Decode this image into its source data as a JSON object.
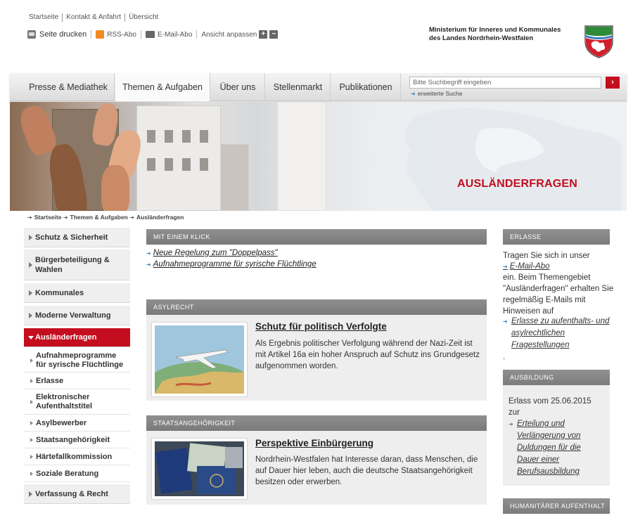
{
  "meta_links": [
    "Startseite",
    "Kontakt & Anfahrt",
    "Übersicht"
  ],
  "tools": {
    "print": "Seite drucken",
    "rss": "RSS-Abo",
    "email": "E-Mail-Abo",
    "view": "Ansicht anpassen",
    "plus": "+",
    "minus": "−"
  },
  "ministry": {
    "line1": "Ministerium für Inneres und Kommunales",
    "line2": "des Landes Nordrhein-Westfalen"
  },
  "nav": [
    "Presse & Mediathek",
    "Themen & Aufgaben",
    "Über uns",
    "Stellenmarkt",
    "Publikationen"
  ],
  "search": {
    "placeholder": "Bitte Suchbegriff eingeben",
    "button": "›",
    "advanced": "erweiterte Suche"
  },
  "banner_title": "AUSLÄNDERFRAGEN",
  "breadcrumb": [
    "Startseite",
    "Themen & Aufgaben",
    "Ausländerfragen"
  ],
  "sidebar": {
    "items": [
      "Schutz & Sicherheit",
      "Bürgerbeteiligung & Wahlen",
      "Kommunales",
      "Moderne Verwaltung",
      "Ausländerfragen",
      "Verfassung & Recht"
    ],
    "sub_items": [
      "Aufnahmeprogramme für syrische Flüchtlinge",
      "Erlasse",
      "Elektronischer Aufenthaltstitel",
      "Asylbewerber",
      "Staatsangehörigkeit",
      "Härtefallkommission",
      "Soziale Beratung"
    ]
  },
  "main": {
    "quick": {
      "heading": "MIT EINEM KLICK",
      "links": [
        "Neue Regelung zum \"Doppelpass\"",
        "Aufnahmeprogramme für syrische Flüchtlinge"
      ]
    },
    "asyl": {
      "heading": "ASYLRECHT",
      "title": "Schutz für politisch Verfolgte",
      "text": "Als Ergebnis politischer Verfolgung während der Nazi-Zeit ist mit Artikel 16a ein hoher Anspruch auf Schutz ins Grundgesetz aufgenommen worden."
    },
    "staat": {
      "heading": "STAATSANGEHÖRIGKEIT",
      "title": "Perspektive Einbürgerung",
      "text": "Nordrhein-Westfalen hat Interesse daran, dass Menschen, die auf Dauer hier leben, auch die deutsche Staatsangehörigkeit besitzen oder erwerben."
    }
  },
  "right": {
    "erlasse": {
      "heading": "ERLASSE",
      "intro": "Tragen Sie sich in unser",
      "mail_link": "E-Mail-Abo",
      "text": "ein. Beim Themengebiet \"Ausländerfragen\" erhalten Sie regelmäßig E-Mails mit Hinweisen auf",
      "link": "Erlasse zu aufenthalts- und asylrechtlichen Fragestellungen",
      "dot": "."
    },
    "ausbildung": {
      "heading": "AUSBILDUNG",
      "text": "Erlass vom 25.06.2015 zur",
      "link": "Erteilung und Verlängerung von Duldungen für die Dauer einer Berufsausbildung"
    },
    "humanitaer": {
      "heading": "HUMANITÄRER AUFENTHALT"
    }
  }
}
